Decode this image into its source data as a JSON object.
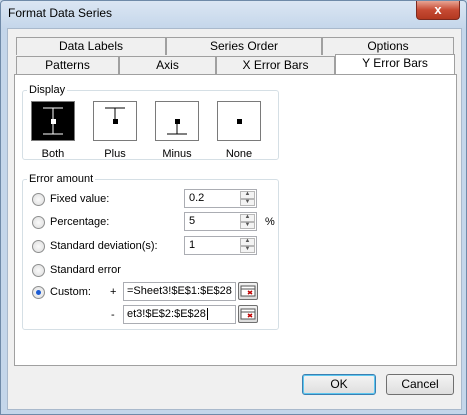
{
  "window": {
    "title": "Format Data Series",
    "close_glyph": "x"
  },
  "tabs": {
    "row_back": [
      "Data Labels",
      "Series Order",
      "Options"
    ],
    "row_front": [
      "Patterns",
      "Axis",
      "X Error Bars",
      "Y Error Bars"
    ],
    "active": "Y Error Bars"
  },
  "display": {
    "label": "Display",
    "options": [
      "Both",
      "Plus",
      "Minus",
      "None"
    ],
    "selected": "Both"
  },
  "error_amount": {
    "label": "Error amount",
    "fixed": {
      "label": "Fixed value:",
      "value": "0.2"
    },
    "percentage": {
      "label": "Percentage:",
      "value": "5",
      "unit": "%"
    },
    "std_dev": {
      "label": "Standard deviation(s):",
      "value": "1"
    },
    "std_error": {
      "label": "Standard error"
    },
    "custom": {
      "label": "Custom:",
      "plus_sign": "+",
      "minus_sign": "-",
      "plus_range": "=Sheet3!$E$1:$E$28",
      "minus_range": "et3!$E$2:$E$28"
    },
    "selected": "custom"
  },
  "buttons": {
    "ok": "OK",
    "cancel": "Cancel"
  },
  "colors": {
    "accent": "#1b5bd3",
    "selection_border": "#3c7fb1",
    "range_icon_red": "#c00000"
  }
}
